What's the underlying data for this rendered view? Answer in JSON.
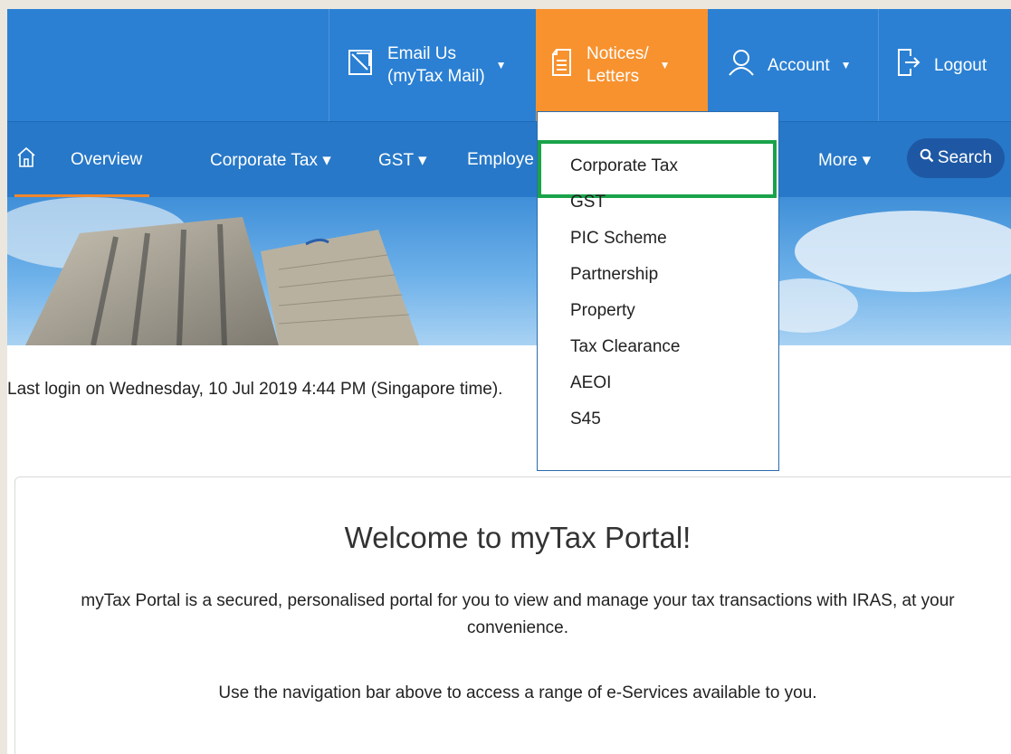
{
  "topbar": {
    "email": {
      "line1": "Email Us",
      "line2": "(myTax Mail)",
      "icon": "envelope-icon"
    },
    "notices": {
      "line1": "Notices/",
      "line2": "Letters",
      "icon": "document-icon"
    },
    "account": {
      "label": "Account",
      "icon": "user-icon"
    },
    "logout": {
      "label": "Logout",
      "icon": "logout-icon"
    },
    "caret": "▼"
  },
  "nav": {
    "overview": "Overview",
    "corporate_tax": "Corporate Tax ▾",
    "gst": "GST ▾",
    "employers": "Employe",
    "more": "More ▾",
    "search": "Search"
  },
  "dropdown": {
    "items": [
      "Corporate Tax",
      "GST",
      "PIC Scheme",
      "Partnership",
      "Property",
      "Tax Clearance",
      "AEOI",
      "S45"
    ]
  },
  "last_login": "Last login on Wednesday, 10 Jul 2019 4:44 PM (Singapore time).",
  "welcome": {
    "title": "Welcome to myTax Portal!",
    "intro": "myTax Portal is a secured, personalised portal for you to view and manage your tax transactions with IRAS, at your convenience.",
    "nav_hint": "Use the navigation bar above to access a range of e-Services available to you."
  },
  "colors": {
    "topbar": "#2b80d3",
    "navbar": "#2778c8",
    "notices_active": "#f7922f",
    "highlight": "#1aa34a"
  }
}
